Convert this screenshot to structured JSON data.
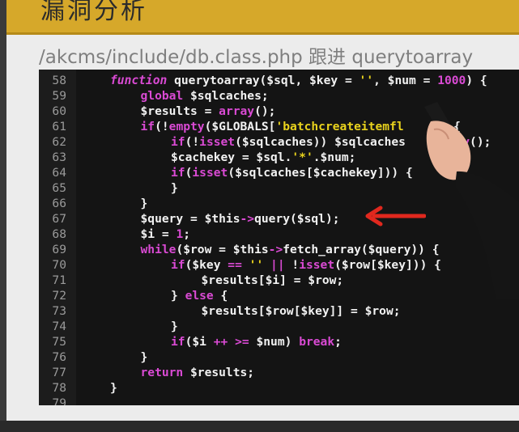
{
  "slide": {
    "header_title": "漏洞分析",
    "path_title": "/akcms/include/db.class.php  跟进 querytoarray"
  },
  "code": {
    "lines": [
      {
        "n": "58",
        "segs": [
          {
            "t": "function",
            "c": "kwi"
          },
          {
            "t": " querytoarray($sql, $key = ",
            "c": ""
          },
          {
            "t": "''",
            "c": "str"
          },
          {
            "t": ", $num = ",
            "c": ""
          },
          {
            "t": "1000",
            "c": "num"
          },
          {
            "t": ") {",
            "c": ""
          }
        ],
        "ind": 0
      },
      {
        "n": "59",
        "segs": [
          {
            "t": "global",
            "c": "kw"
          },
          {
            "t": " $sqlcaches;",
            "c": ""
          }
        ],
        "ind": 1
      },
      {
        "n": "60",
        "segs": [
          {
            "t": "$results = ",
            "c": ""
          },
          {
            "t": "array",
            "c": "kw"
          },
          {
            "t": "();",
            "c": ""
          }
        ],
        "ind": 1
      },
      {
        "n": "61",
        "segs": [
          {
            "t": "if",
            "c": "kw"
          },
          {
            "t": "(!",
            "c": ""
          },
          {
            "t": "empty",
            "c": "kw"
          },
          {
            "t": "($GLOBALS[",
            "c": ""
          },
          {
            "t": "'batchcreateitemfl",
            "c": "str"
          },
          {
            "t": "     ) {",
            "c": ""
          }
        ],
        "ind": 1
      },
      {
        "n": "62",
        "segs": [
          {
            "t": "if",
            "c": "kw"
          },
          {
            "t": "(!",
            "c": ""
          },
          {
            "t": "isset",
            "c": "kw"
          },
          {
            "t": "($sqlcaches)) $sqlcaches ",
            "c": ""
          },
          {
            "t": "      ay",
            "c": "kw"
          },
          {
            "t": "();",
            "c": ""
          }
        ],
        "ind": 2
      },
      {
        "n": "63",
        "segs": [
          {
            "t": "$cachekey = $sql.",
            "c": ""
          },
          {
            "t": "'*'",
            "c": "str"
          },
          {
            "t": ".$num;",
            "c": ""
          }
        ],
        "ind": 2
      },
      {
        "n": "64",
        "segs": [
          {
            "t": "if",
            "c": "kw"
          },
          {
            "t": "(",
            "c": ""
          },
          {
            "t": "isset",
            "c": "kw"
          },
          {
            "t": "($sqlcaches[$cachekey])) {",
            "c": ""
          }
        ],
        "ind": 2
      },
      {
        "n": "65",
        "segs": [
          {
            "t": "}",
            "c": ""
          }
        ],
        "ind": 2
      },
      {
        "n": "66",
        "segs": [
          {
            "t": "}",
            "c": ""
          }
        ],
        "ind": 1
      },
      {
        "n": "67",
        "segs": [
          {
            "t": "$query = $this",
            "c": ""
          },
          {
            "t": "->",
            "c": "kw"
          },
          {
            "t": "query($sql);",
            "c": ""
          }
        ],
        "ind": 1
      },
      {
        "n": "68",
        "segs": [
          {
            "t": "$i = ",
            "c": ""
          },
          {
            "t": "1",
            "c": "num"
          },
          {
            "t": ";",
            "c": ""
          }
        ],
        "ind": 1
      },
      {
        "n": "69",
        "segs": [
          {
            "t": "while",
            "c": "kw"
          },
          {
            "t": "($row = $this",
            "c": ""
          },
          {
            "t": "->",
            "c": "kw"
          },
          {
            "t": "fetch_array($query)) {",
            "c": ""
          }
        ],
        "ind": 1
      },
      {
        "n": "70",
        "segs": [
          {
            "t": "if",
            "c": "kw"
          },
          {
            "t": "($key ",
            "c": ""
          },
          {
            "t": "==",
            "c": "kw"
          },
          {
            "t": " ",
            "c": ""
          },
          {
            "t": "''",
            "c": "str"
          },
          {
            "t": " ",
            "c": ""
          },
          {
            "t": "||",
            "c": "kw"
          },
          {
            "t": " !",
            "c": ""
          },
          {
            "t": "isset",
            "c": "kw"
          },
          {
            "t": "($row[$key])) {",
            "c": ""
          }
        ],
        "ind": 2
      },
      {
        "n": "71",
        "segs": [
          {
            "t": "$results[$i] = $row;",
            "c": ""
          }
        ],
        "ind": 3
      },
      {
        "n": "72",
        "segs": [
          {
            "t": "} ",
            "c": ""
          },
          {
            "t": "else",
            "c": "kw"
          },
          {
            "t": " {",
            "c": ""
          }
        ],
        "ind": 2
      },
      {
        "n": "73",
        "segs": [
          {
            "t": "$results[$row[$key]] = $row;",
            "c": ""
          }
        ],
        "ind": 3
      },
      {
        "n": "74",
        "segs": [
          {
            "t": "}",
            "c": ""
          }
        ],
        "ind": 2
      },
      {
        "n": "75",
        "segs": [
          {
            "t": "if",
            "c": "kw"
          },
          {
            "t": "($i ",
            "c": ""
          },
          {
            "t": "++",
            "c": "kw"
          },
          {
            "t": " ",
            "c": ""
          },
          {
            "t": ">=",
            "c": "kw"
          },
          {
            "t": " $num) ",
            "c": ""
          },
          {
            "t": "break",
            "c": "kw"
          },
          {
            "t": ";",
            "c": ""
          }
        ],
        "ind": 2
      },
      {
        "n": "76",
        "segs": [
          {
            "t": "}",
            "c": ""
          }
        ],
        "ind": 1
      },
      {
        "n": "77",
        "segs": [
          {
            "t": "return",
            "c": "kw"
          },
          {
            "t": " $results;",
            "c": ""
          }
        ],
        "ind": 1
      },
      {
        "n": "78",
        "segs": [
          {
            "t": "}",
            "c": ""
          }
        ],
        "ind": 0
      },
      {
        "n": "79",
        "segs": [],
        "ind": 0
      }
    ]
  },
  "annotation": {
    "arrow_color": "#e0281e",
    "arrow_target_line": "67"
  },
  "colors": {
    "keyword": "#d94ad3",
    "string": "#e8d21d",
    "text": "#f2f2f2",
    "header_band": "#d6a82a"
  }
}
